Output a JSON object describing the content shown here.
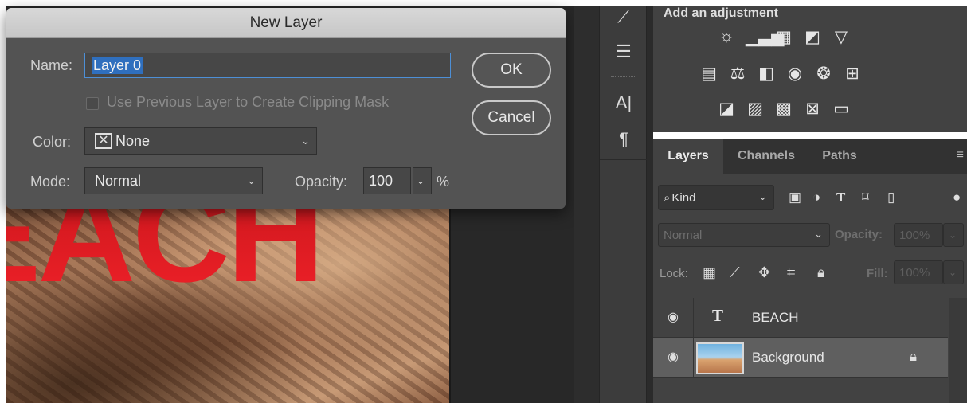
{
  "dialog": {
    "title": "New Layer",
    "name_label": "Name:",
    "name_value": "Layer 0",
    "clipping_label": "Use Previous Layer to Create Clipping Mask",
    "clipping_checked": false,
    "color_label": "Color:",
    "color_value": "None",
    "mode_label": "Mode:",
    "mode_value": "Normal",
    "opacity_label": "Opacity:",
    "opacity_value": "100",
    "opacity_unit": "%",
    "ok_label": "OK",
    "cancel_label": "Cancel"
  },
  "canvas": {
    "text_layer_content": "EACH"
  },
  "adjustments": {
    "title": "Add an adjustment",
    "row1": [
      "brightness-icon",
      "levels-icon",
      "curves-icon",
      "exposure-icon",
      "gradient-triangle-icon"
    ],
    "row2": [
      "vibrance-icon",
      "balance-icon",
      "black-white-icon",
      "photo-filter-icon",
      "channel-mixer-icon",
      "color-lookup-icon"
    ],
    "row3": [
      "invert-icon",
      "posterize-icon",
      "threshold-icon",
      "selective-color-icon",
      "gradient-map-icon"
    ]
  },
  "layers_panel": {
    "tabs": [
      "Layers",
      "Channels",
      "Paths"
    ],
    "active_tab": "Layers",
    "filter_kind": "Kind",
    "blend_mode": "Normal",
    "opacity_label": "Opacity:",
    "opacity_value": "100%",
    "lock_label": "Lock:",
    "fill_label": "Fill:",
    "fill_value": "100%",
    "layers": [
      {
        "name": "BEACH",
        "type": "text",
        "visible": true
      },
      {
        "name": "Background",
        "type": "image",
        "visible": true,
        "locked": true,
        "selected": true
      }
    ]
  },
  "colors": {
    "dialog_bg": "#535353",
    "selection_blue": "#2f6fbe",
    "text_red": "#e11b22",
    "panel_bg": "#424242"
  }
}
